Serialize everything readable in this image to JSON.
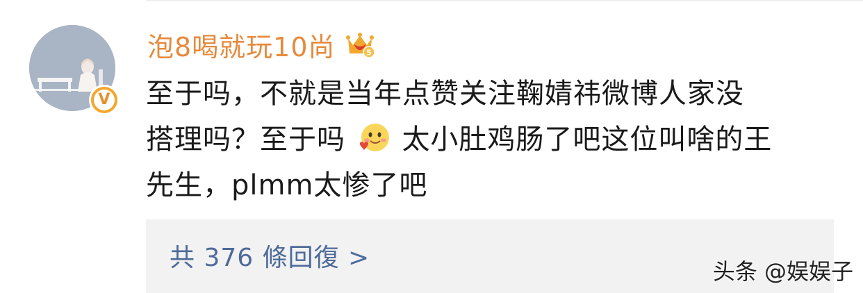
{
  "comment": {
    "username": "泡8喝就玩10尚",
    "level_badge": "5",
    "verified_mark": "V",
    "text_lines": [
      "至于吗，不就是当年点赞关注鞠婧祎微博人家没",
      "搭理吗？至于吗",
      "太小肚鸡肠了吧这位叫啥的王",
      "先生，plmm太惨了吧"
    ],
    "emoji": "smiling-blush-heart-icon"
  },
  "replies": {
    "label": "共 376 條回復 >"
  },
  "watermark": {
    "text": "头条 @娱娱子"
  },
  "colors": {
    "username": "#e68a3c",
    "reply_link": "#4d6a9a",
    "reply_bg": "#f2f2f2",
    "verified_badge": "#f3a72d"
  }
}
